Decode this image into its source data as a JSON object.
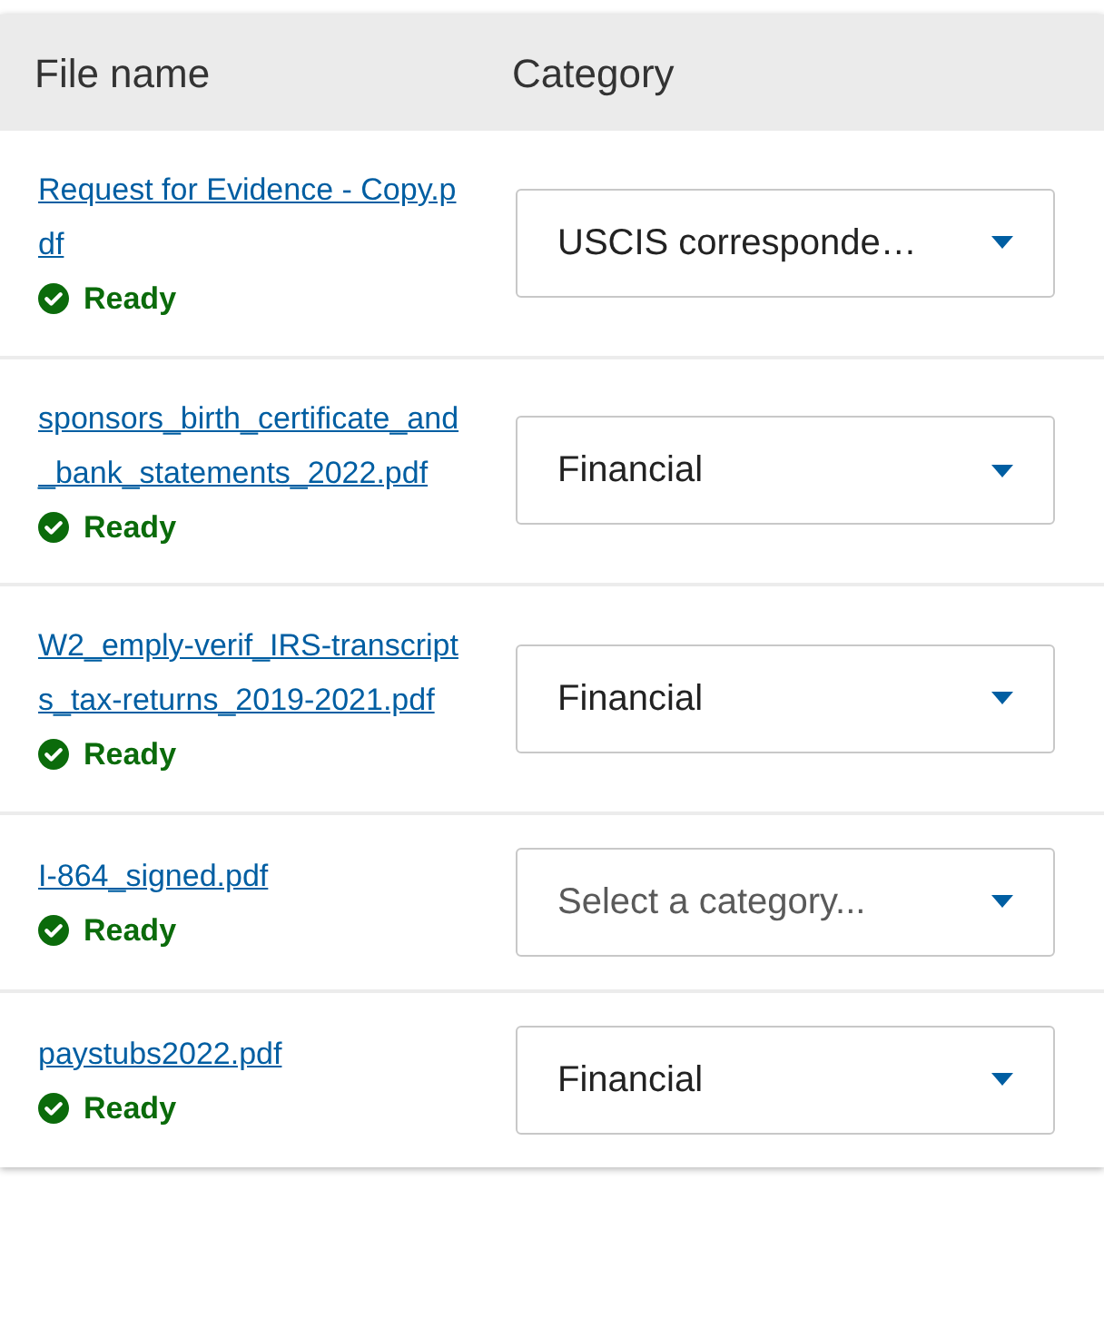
{
  "table": {
    "columns": [
      "File name",
      "Category"
    ],
    "rows": [
      {
        "file_name": "Request for Evidence - Copy.pdf",
        "status": {
          "kind": "ready",
          "label": "Ready"
        },
        "category": {
          "value": "USCIS corresponde…"
        }
      },
      {
        "file_name": "sponsors_birth_certificate_and_bank_statements_2022.pdf",
        "status": {
          "kind": "ready",
          "label": "Ready"
        },
        "category": {
          "value": "Financial"
        }
      },
      {
        "file_name": "W2_emply-verif_IRS-transcripts_tax-returns_2019-2021.pdf",
        "status": {
          "kind": "ready",
          "label": "Ready"
        },
        "category": {
          "value": "Financial"
        }
      },
      {
        "file_name": "I-864_signed.pdf",
        "status": {
          "kind": "ready",
          "label": "Ready"
        },
        "category": {
          "placeholder": "Select a category..."
        }
      },
      {
        "file_name": "paystubs2022.pdf",
        "status": {
          "kind": "ready",
          "label": "Ready"
        },
        "category": {
          "value": "Financial"
        }
      }
    ]
  }
}
